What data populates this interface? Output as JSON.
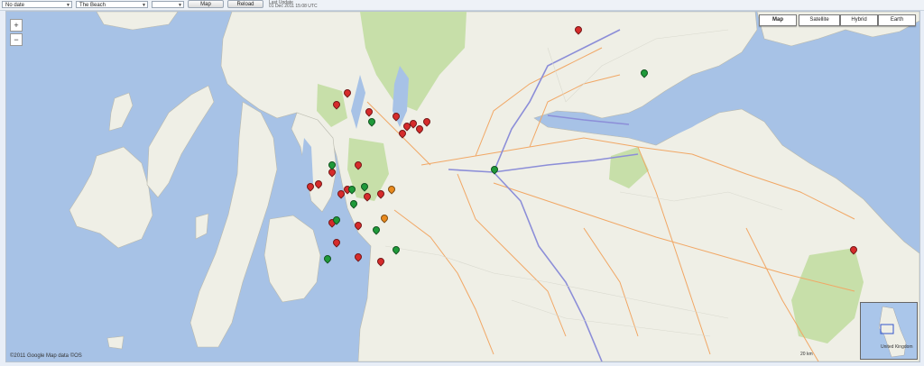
{
  "toolbar": {
    "select1": "No date",
    "select2": "The Beach",
    "select3": "",
    "btn1": "Map",
    "btn2": "Reload",
    "status_line1": "Last Update",
    "status_line2": "01 Dec 2011 15:08 UTC",
    "status_line3": "Scotland Coast"
  },
  "map": {
    "types": [
      "Map",
      "Satellite",
      "Hybrid",
      "Earth"
    ],
    "active_type": "Map",
    "attribution": "©2011 Google Map data ©OS",
    "overview_label": "United Kingdom",
    "scale_label": "20 km",
    "colors": {
      "water": "#a7c2e6",
      "land": "#efefe6",
      "park": "#c7dfa9",
      "marker_red": "#d62b2b",
      "marker_green": "#1f9a3a",
      "marker_orange": "#e98a1d"
    }
  },
  "markers": [
    {
      "color": "red",
      "lon": -4.28,
      "lat": 55.86
    },
    {
      "color": "red",
      "lon": -4.25,
      "lat": 55.87
    },
    {
      "color": "red",
      "lon": -4.22,
      "lat": 55.85
    },
    {
      "color": "red",
      "lon": -4.19,
      "lat": 55.88
    },
    {
      "color": "red",
      "lon": -4.3,
      "lat": 55.83
    },
    {
      "color": "red",
      "lon": -4.33,
      "lat": 55.9
    },
    {
      "color": "red",
      "lon": -4.45,
      "lat": 55.92
    },
    {
      "color": "red",
      "lon": -4.6,
      "lat": 55.95
    },
    {
      "color": "red",
      "lon": -4.5,
      "lat": 55.7
    },
    {
      "color": "red",
      "lon": -4.62,
      "lat": 55.67
    },
    {
      "color": "red",
      "lon": -4.68,
      "lat": 55.62
    },
    {
      "color": "red",
      "lon": -4.72,
      "lat": 55.61
    },
    {
      "color": "red",
      "lon": -4.55,
      "lat": 55.6
    },
    {
      "color": "red",
      "lon": -4.58,
      "lat": 55.58
    },
    {
      "color": "red",
      "lon": -4.46,
      "lat": 55.57
    },
    {
      "color": "red",
      "lon": -4.4,
      "lat": 55.58
    },
    {
      "color": "red",
      "lon": -4.5,
      "lat": 55.45
    },
    {
      "color": "red",
      "lon": -4.62,
      "lat": 55.46
    },
    {
      "color": "red",
      "lon": -4.6,
      "lat": 55.38
    },
    {
      "color": "red",
      "lon": -4.5,
      "lat": 55.32
    },
    {
      "color": "red",
      "lon": -4.4,
      "lat": 55.3
    },
    {
      "color": "red",
      "lon": -3.5,
      "lat": 56.26
    },
    {
      "color": "red",
      "lon": -2.25,
      "lat": 55.35
    },
    {
      "color": "red",
      "lon": -4.55,
      "lat": 56.0
    },
    {
      "color": "green",
      "lon": -4.44,
      "lat": 55.88
    },
    {
      "color": "green",
      "lon": -4.53,
      "lat": 55.6
    },
    {
      "color": "green",
      "lon": -4.52,
      "lat": 55.54
    },
    {
      "color": "green",
      "lon": -4.47,
      "lat": 55.61
    },
    {
      "color": "green",
      "lon": -4.6,
      "lat": 55.47
    },
    {
      "color": "green",
      "lon": -4.42,
      "lat": 55.43
    },
    {
      "color": "green",
      "lon": -4.33,
      "lat": 55.35
    },
    {
      "color": "green",
      "lon": -4.64,
      "lat": 55.31
    },
    {
      "color": "green",
      "lon": -3.88,
      "lat": 55.68
    },
    {
      "color": "green",
      "lon": -3.2,
      "lat": 56.08
    },
    {
      "color": "green",
      "lon": -4.62,
      "lat": 55.7
    },
    {
      "color": "orange",
      "lon": -4.38,
      "lat": 55.48
    },
    {
      "color": "orange",
      "lon": -4.35,
      "lat": 55.6
    }
  ]
}
